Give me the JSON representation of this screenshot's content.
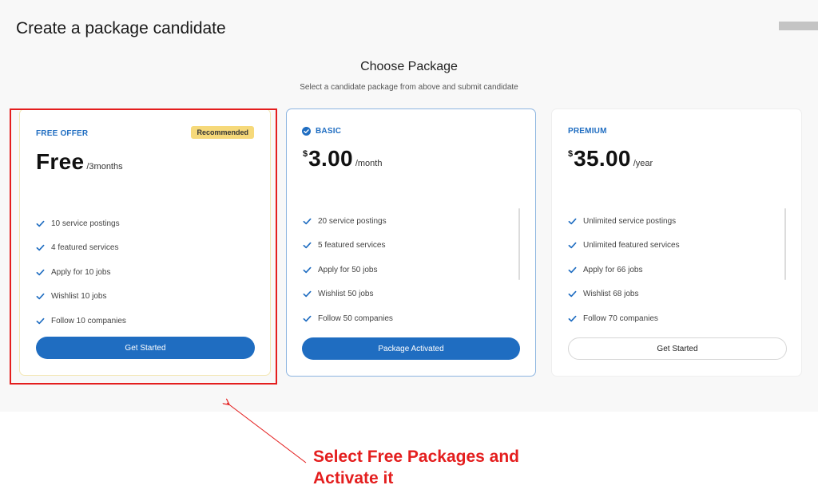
{
  "page": {
    "title": "Create a package candidate"
  },
  "section": {
    "title": "Choose Package",
    "subtitle": "Select a candidate package from above and submit candidate"
  },
  "plans": [
    {
      "name": "FREE OFFER",
      "badge": "Recommended",
      "price": "Free",
      "period": "/3months",
      "features": [
        "10 service postings",
        "4 featured services",
        "Apply for 10 jobs",
        "Wishlist 10 jobs",
        "Follow 10 companies"
      ],
      "cta": "Get Started"
    },
    {
      "name": "BASIC",
      "active_icon": "check-circle-icon",
      "currency": "$",
      "price": "3.00",
      "period": "/month",
      "features": [
        "20 service postings",
        "5 featured services",
        "Apply for 50 jobs",
        "Wishlist 50 jobs",
        "Follow 50 companies"
      ],
      "cta": "Package Activated"
    },
    {
      "name": "PREMIUM",
      "currency": "$",
      "price": "35.00",
      "period": "/year",
      "features": [
        "Unlimited service postings",
        "Unlimited featured services",
        "Apply for 66 jobs",
        "Wishlist 68 jobs",
        "Follow 70 companies"
      ],
      "cta": "Get Started"
    }
  ],
  "annotation": {
    "line1": "Select Free Packages and",
    "line2": "Activate it"
  },
  "colors": {
    "accent": "#1f6dc1",
    "badge": "#f6d97a",
    "annotation": "#e41e1e"
  }
}
